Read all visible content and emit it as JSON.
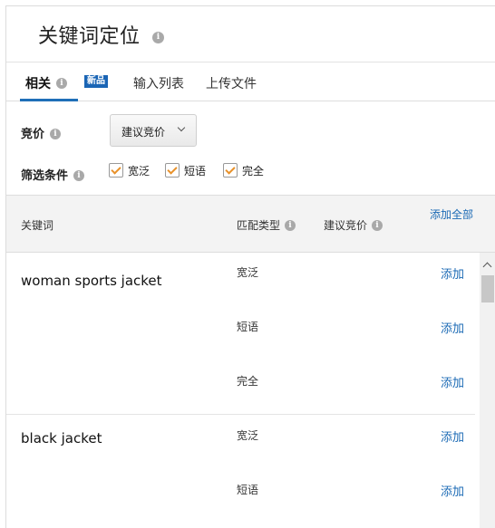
{
  "title": "关键词定位",
  "tabs": [
    {
      "label": "相关",
      "badge": "新品"
    },
    {
      "label": "输入列表"
    },
    {
      "label": "上传文件"
    }
  ],
  "bid": {
    "label": "竞价",
    "select_value": "建议竞价"
  },
  "filter": {
    "label": "筛选条件",
    "options": [
      {
        "label": "宽泛",
        "checked": true
      },
      {
        "label": "短语",
        "checked": true
      },
      {
        "label": "完全",
        "checked": true
      }
    ]
  },
  "table": {
    "headers": {
      "keyword": "关键词",
      "match_type": "匹配类型",
      "suggested_bid": "建议竞价",
      "add_all": "添加全部"
    },
    "groups": [
      {
        "keyword": "woman sports jacket",
        "rows": [
          {
            "match": "宽泛",
            "action": "添加"
          },
          {
            "match": "短语",
            "action": "添加"
          },
          {
            "match": "完全",
            "action": "添加"
          }
        ]
      },
      {
        "keyword": "black jacket",
        "rows": [
          {
            "match": "宽泛",
            "action": "添加"
          },
          {
            "match": "短语",
            "action": "添加"
          }
        ]
      }
    ]
  },
  "icons": {
    "info": "info-icon",
    "dropdown": "chevron-down-icon",
    "scroll": "chevron-up-icon"
  },
  "colors": {
    "link": "#1b6ab5",
    "badge": "#1a65b5",
    "check": "#e8912a",
    "tab_underline": "#1f6fb8"
  }
}
